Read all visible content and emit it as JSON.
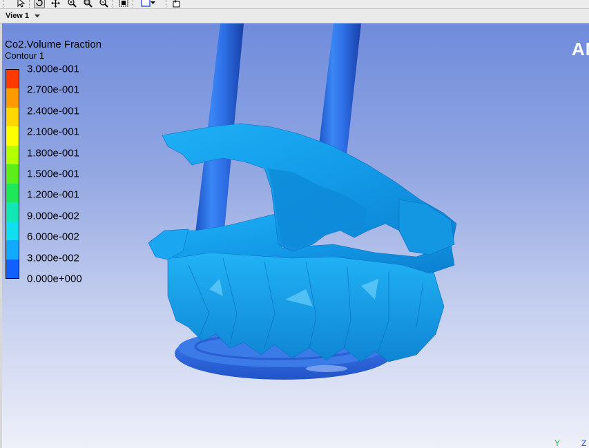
{
  "toolbar": {
    "tools": [
      {
        "name": "select-tool",
        "icon": "arrow-cursor-icon"
      },
      {
        "name": "rotate-tool",
        "icon": "rotate-icon",
        "active": true
      },
      {
        "name": "pan-tool",
        "icon": "pan-icon"
      },
      {
        "name": "zoom-tool",
        "icon": "zoom-icon"
      },
      {
        "name": "zoom-box-tool",
        "icon": "zoom-box-icon"
      },
      {
        "name": "zoom-fit-tool",
        "icon": "zoom-fit-icon"
      },
      {
        "name": "fit-view-tool",
        "icon": "fit-view-icon"
      },
      {
        "name": "viewport-layout-tool",
        "icon": "viewport-layout-icon"
      },
      {
        "name": "new-window-tool",
        "icon": "new-window-icon"
      }
    ]
  },
  "view": {
    "label": "View 1",
    "dropdown_icon": "chevron-down-icon"
  },
  "legend": {
    "title": "Co2.Volume Fraction",
    "subtitle": "Contour 1",
    "ticks": [
      "3.000e-001",
      "2.700e-001",
      "2.400e-001",
      "2.100e-001",
      "1.800e-001",
      "1.500e-001",
      "1.200e-001",
      "9.000e-002",
      "6.000e-002",
      "3.000e-002",
      "0.000e+000"
    ],
    "colors": [
      "#ff3a00",
      "#ff9a00",
      "#ffd800",
      "#ffff00",
      "#b4ff00",
      "#5aee1a",
      "#1ee85a",
      "#12e6b4",
      "#10e0ee",
      "#12aaff",
      "#1060ff"
    ]
  },
  "brand_text": "AN",
  "axes": {
    "y_label": "Y",
    "z_label": "Z"
  },
  "theme": {
    "surface_color": "#1aa6f2",
    "cylinder_color": "#2d72ea"
  }
}
